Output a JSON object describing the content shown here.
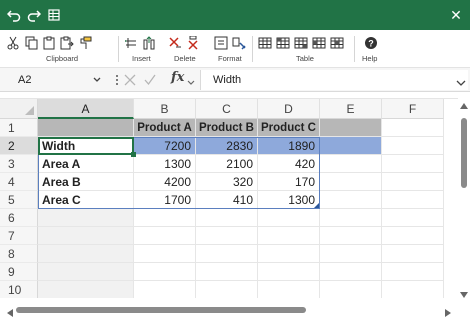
{
  "colors": {
    "titlebar": "#217346",
    "selection": "#217346",
    "header_fill": "#b7b7b7",
    "row_highlight": "#8ea9db",
    "table_border": "#5b7fbf"
  },
  "titlebar": {
    "icons": [
      "undo-icon",
      "redo-icon",
      "quick-access-icon"
    ],
    "close_glyph": "✕"
  },
  "ribbon": {
    "groups": [
      {
        "label": "Clipboard",
        "icons": [
          "cut-icon",
          "copy-icon",
          "paste-icon",
          "paste-special-icon",
          "format-painter-icon"
        ]
      },
      {
        "label": "Insert",
        "icons": [
          "insert-rows-icon",
          "insert-columns-icon"
        ]
      },
      {
        "label": "Delete",
        "icons": [
          "delete-rows-icon",
          "delete-columns-icon"
        ]
      },
      {
        "label": "Format",
        "icons": [
          "format-cells-icon",
          "clear-format-icon"
        ]
      },
      {
        "label": "Table",
        "icons": [
          "table-style-1-icon",
          "table-style-2-icon",
          "table-style-3-icon",
          "table-style-4-icon",
          "table-style-5-icon"
        ]
      },
      {
        "label": "Help",
        "icons": [
          "help-icon"
        ]
      }
    ]
  },
  "formula_bar": {
    "name_box": "A2",
    "fx_label": "fx",
    "formula": "Width"
  },
  "grid": {
    "columns": [
      "A",
      "B",
      "C",
      "D",
      "E",
      "F"
    ],
    "rows": [
      "1",
      "2",
      "3",
      "4",
      "5",
      "6",
      "7",
      "8",
      "9",
      "10"
    ],
    "selected_cell": "A2",
    "table": {
      "headers": [
        "",
        "Product A",
        "Product B",
        "Product C"
      ],
      "rows": [
        [
          "Width",
          "7200",
          "2830",
          "1890"
        ],
        [
          "Area A",
          "1300",
          "2100",
          "420"
        ],
        [
          "Area B",
          "4200",
          "320",
          "170"
        ],
        [
          "Area C",
          "1700",
          "410",
          "1300"
        ]
      ]
    }
  }
}
